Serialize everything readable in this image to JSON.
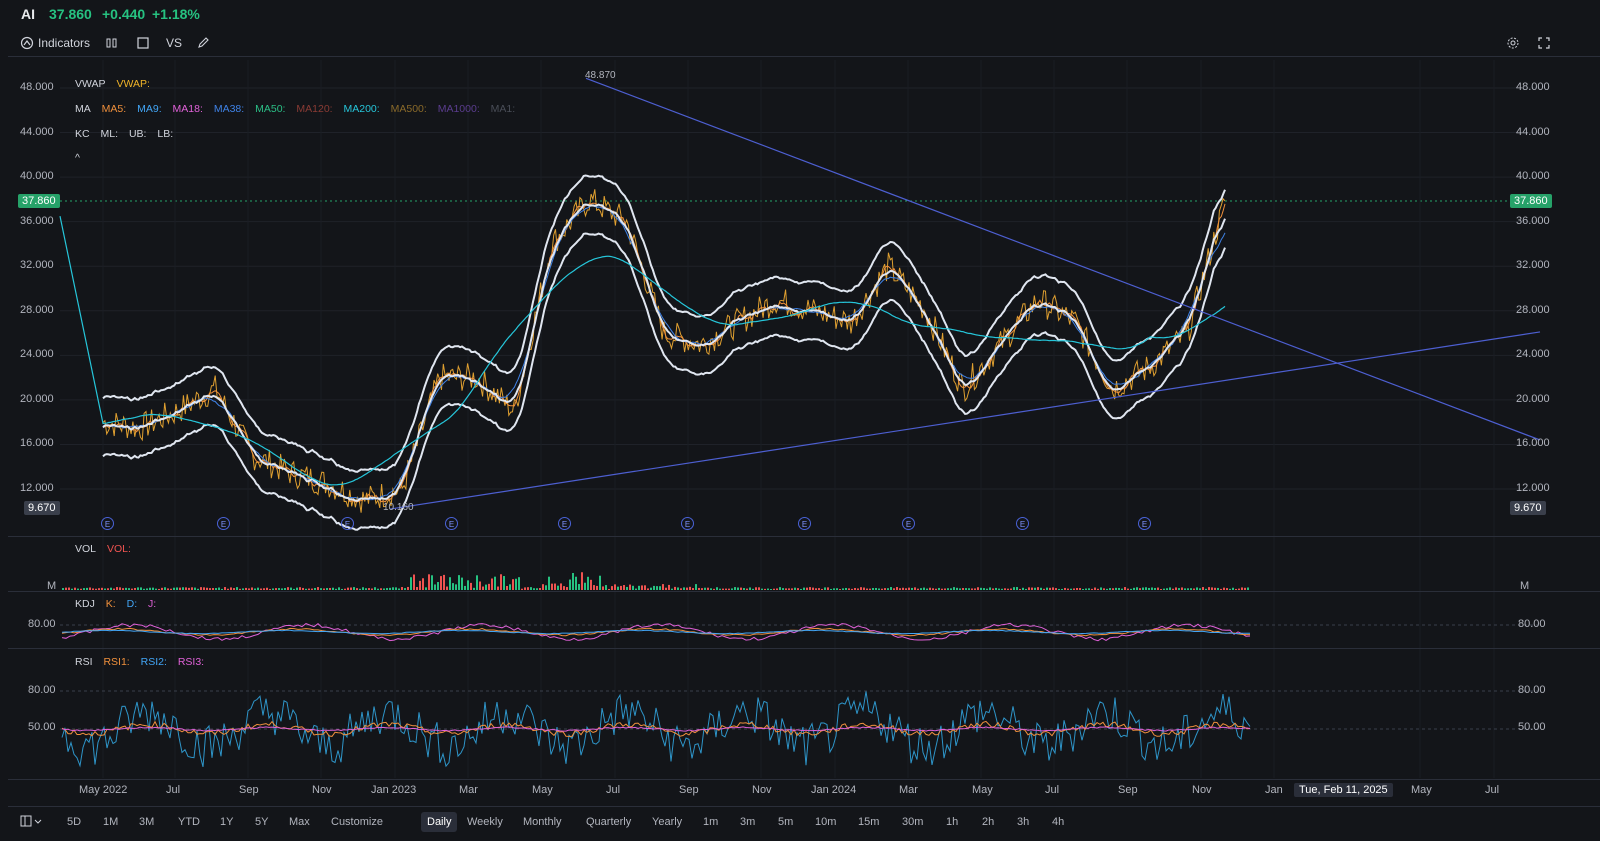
{
  "ticker": {
    "symbol": "AI",
    "price": "37.860",
    "change": "+0.440",
    "change_pct": "+1.18%"
  },
  "toolbar": {
    "indicators_label": "Indicators",
    "vs_label": "VS"
  },
  "icons": {
    "indicators": "indicator-icon",
    "candle": "candlestick-icon",
    "rect": "rectangle-icon",
    "draw": "pencil-icon",
    "settings": "gear-icon",
    "fullscreen": "fullscreen-icon",
    "layout": "layout-icon"
  },
  "colors": {
    "up": "#26c281",
    "down": "#ef5350",
    "price_tag": "#26a269",
    "trendline": "#4d5fd1",
    "ma200": "#26c6da",
    "kc": "#e0e6f0"
  },
  "legend": {
    "vwap": {
      "name": "VWAP",
      "items": [
        "VWAP:"
      ]
    },
    "ma": {
      "name": "MA",
      "items": [
        "MA5:",
        "MA9:",
        "MA18:",
        "MA38:",
        "MA50:",
        "MA120:",
        "MA200:",
        "MA500:",
        "MA1000:",
        "MA1:"
      ]
    },
    "kc": {
      "name": "KC",
      "items": [
        "ML:",
        "UB:",
        "LB:"
      ]
    },
    "collapse": "^"
  },
  "price_axis": {
    "ticks": [
      "48.000",
      "44.000",
      "40.000",
      "36.000",
      "32.000",
      "28.000",
      "24.000",
      "20.000",
      "16.000",
      "12.000"
    ],
    "current": "37.860",
    "low": "9.670"
  },
  "annotations": {
    "high": "48.870",
    "low": "10.160"
  },
  "earnings_marker": "E",
  "volume": {
    "name": "VOL",
    "label": "VOL:",
    "unit": "M"
  },
  "kdj": {
    "name": "KDJ",
    "items": [
      "K:",
      "D:",
      "J:"
    ],
    "tick": "80.00"
  },
  "rsi": {
    "name": "RSI",
    "items": [
      "RSI1:",
      "RSI2:",
      "RSI3:"
    ],
    "ticks": [
      "80.00",
      "50.00"
    ]
  },
  "time_axis": {
    "labels": [
      "May 2022",
      "Jul",
      "Sep",
      "Nov",
      "Jan 2023",
      "Mar",
      "May",
      "Jul",
      "Sep",
      "Nov",
      "Jan 2024",
      "Mar",
      "May",
      "Jul",
      "Sep",
      "Nov",
      "Jan",
      "May",
      "Jul"
    ],
    "crosshair": "Tue, Feb 11, 2025"
  },
  "timeframes": [
    "5D",
    "1M",
    "3M",
    "YTD",
    "1Y",
    "5Y",
    "Max",
    "Customize",
    "Daily",
    "Weekly",
    "Monthly",
    "Quarterly",
    "Yearly",
    "1m",
    "3m",
    "5m",
    "10m",
    "15m",
    "30m",
    "1h",
    "2h",
    "3h",
    "4h"
  ],
  "active_timeframe": "Daily",
  "chart_data": {
    "type": "line",
    "title": "AI",
    "xlabel": "",
    "ylabel": "",
    "ylim": [
      9,
      50
    ],
    "x": [
      "2022-05",
      "2022-06",
      "2022-07",
      "2022-08",
      "2022-09",
      "2022-10",
      "2022-11",
      "2022-12",
      "2023-01",
      "2023-02",
      "2023-03",
      "2023-04",
      "2023-05",
      "2023-06",
      "2023-07",
      "2023-08",
      "2023-09",
      "2023-10",
      "2023-11",
      "2023-12",
      "2024-01",
      "2024-02",
      "2024-03",
      "2024-04",
      "2024-05",
      "2024-06",
      "2024-07",
      "2024-08",
      "2024-09",
      "2024-10",
      "2024-11"
    ],
    "series": [
      {
        "values": [
          18,
          17.5,
          19,
          21,
          15,
          13.5,
          12.5,
          11,
          12,
          22,
          22,
          19,
          34,
          38,
          36,
          26,
          25,
          27,
          29,
          28,
          27,
          32,
          28,
          21,
          25,
          29,
          27,
          21,
          23,
          26,
          37.86
        ]
      }
    ]
  }
}
